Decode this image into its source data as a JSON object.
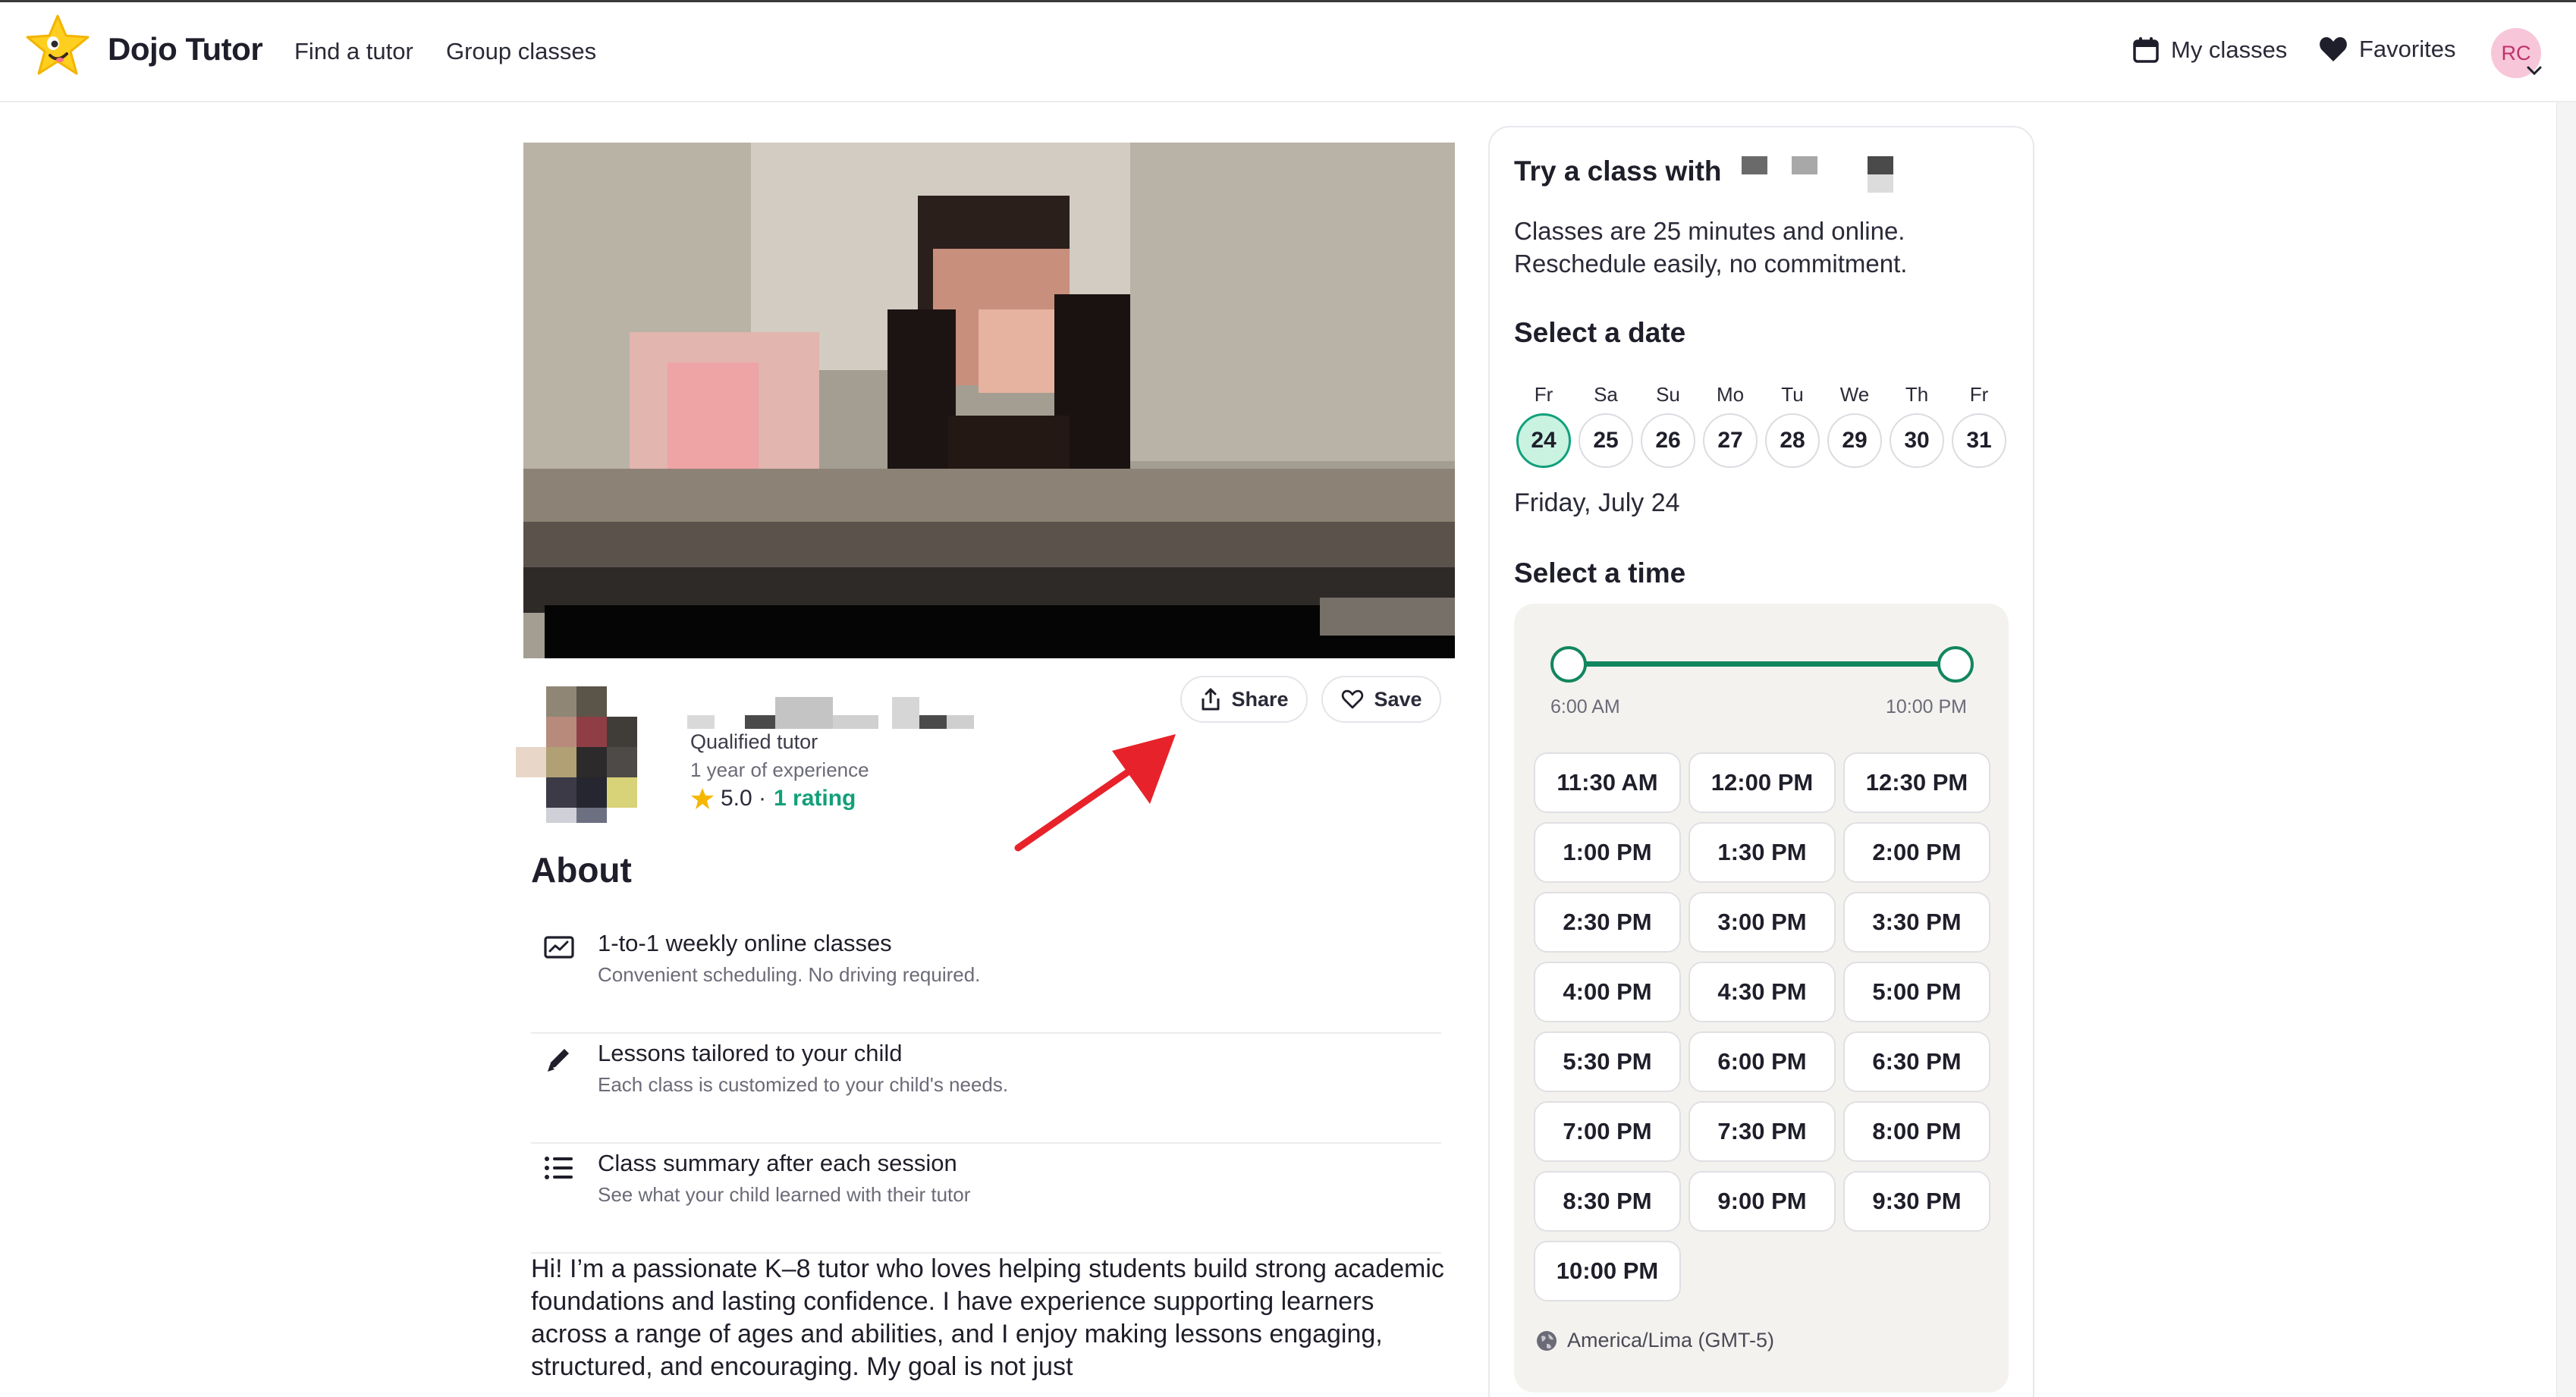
{
  "header": {
    "brand": "Dojo Tutor",
    "nav": [
      "Find a tutor",
      "Group classes"
    ],
    "my_classes": "My classes",
    "favorites": "Favorites",
    "avatar_initials": "RC"
  },
  "colors": {
    "accent_green": "#12a07a",
    "range_green": "#12865f",
    "selected_date_bg": "#c9f2e1",
    "avatar_bg": "#f7c6d9",
    "annotation_red": "#e8222a",
    "star_yellow": "#f6b700"
  },
  "icons": {
    "logo": "dojo-star-logo",
    "my_classes": "calendar-icon",
    "favorites": "heart-icon",
    "share": "share-icon",
    "save": "heart-outline-icon",
    "rating": "star-icon",
    "feature_1": "chart-screen-icon",
    "feature_2": "pencil-icon",
    "feature_3": "list-icon",
    "timezone": "globe-icon"
  },
  "tutor": {
    "qualification": "Qualified tutor",
    "experience": "1 year of experience",
    "rating": "5.0 ·",
    "rating_count": "1 rating"
  },
  "actions": {
    "share": "Share",
    "save": "Save"
  },
  "about": {
    "title": "About",
    "features": [
      {
        "title": "1-to-1 weekly online classes",
        "subtitle": "Convenient scheduling. No driving required."
      },
      {
        "title": "Lessons tailored to your child",
        "subtitle": "Each class is customized to your child's needs."
      },
      {
        "title": "Class summary after each session",
        "subtitle": "See what your child learned with their tutor"
      }
    ],
    "bio": "Hi! I’m a passionate K–8 tutor who loves helping students build strong academic foundations and lasting confidence. I have experience supporting learners across a range of ages and abilities, and I enjoy making lessons engaging, structured, and encouraging. My goal is not just"
  },
  "booking": {
    "title": "Try a class with",
    "description": "Classes are 25 minutes and online. Reschedule easily, no commitment.",
    "select_date_label": "Select a date",
    "days": [
      {
        "name": "Fr",
        "num": "24",
        "selected": true
      },
      {
        "name": "Sa",
        "num": "25"
      },
      {
        "name": "Su",
        "num": "26"
      },
      {
        "name": "Mo",
        "num": "27"
      },
      {
        "name": "Tu",
        "num": "28"
      },
      {
        "name": "We",
        "num": "29"
      },
      {
        "name": "Th",
        "num": "30"
      },
      {
        "name": "Fr",
        "num": "31"
      }
    ],
    "selected_date": "Friday, July 24",
    "select_time_label": "Select a time",
    "range_min": "6:00 AM",
    "range_max": "10:00 PM",
    "slots": [
      "11:30 AM",
      "12:00 PM",
      "12:30 PM",
      "1:00 PM",
      "1:30 PM",
      "2:00 PM",
      "2:30 PM",
      "3:00 PM",
      "3:30 PM",
      "4:00 PM",
      "4:30 PM",
      "5:00 PM",
      "5:30 PM",
      "6:00 PM",
      "6:30 PM",
      "7:00 PM",
      "7:30 PM",
      "8:00 PM",
      "8:30 PM",
      "9:00 PM",
      "9:30 PM",
      "10:00 PM"
    ],
    "timezone": "America/Lima (GMT-5)"
  }
}
